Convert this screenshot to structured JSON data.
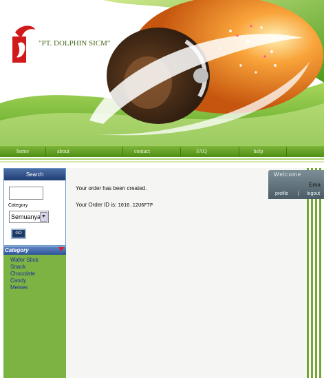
{
  "header": {
    "company_name": "\"PT. DOLPHIN SICM\""
  },
  "nav": {
    "items": [
      "home",
      "about",
      "contact",
      "FAQ",
      "help"
    ]
  },
  "search_panel": {
    "title": "Search",
    "search_value": "",
    "category_label": "Category",
    "category_selected": "Semuanya",
    "go_label": "GO"
  },
  "category_panel": {
    "title": "Category",
    "items": [
      "Wafer Stick",
      "Snack",
      "Chocolate",
      "Candy",
      "Meises"
    ]
  },
  "main": {
    "message": "Your order has been created.",
    "order_id_label": "Your Order ID is:",
    "order_id": "1016.12U6F7P"
  },
  "welcome_box": {
    "title": "Welcome",
    "username": "Erna",
    "profile_label": "profile",
    "separator": "|",
    "logout_label": "logout"
  },
  "colors": {
    "nav_green": "#5a9a1e",
    "sidebar_green": "#7cb342",
    "search_header_blue": "#1e3d73",
    "category_link_blue": "#1b2f9c",
    "welcome_gray": "#5d6e78"
  }
}
